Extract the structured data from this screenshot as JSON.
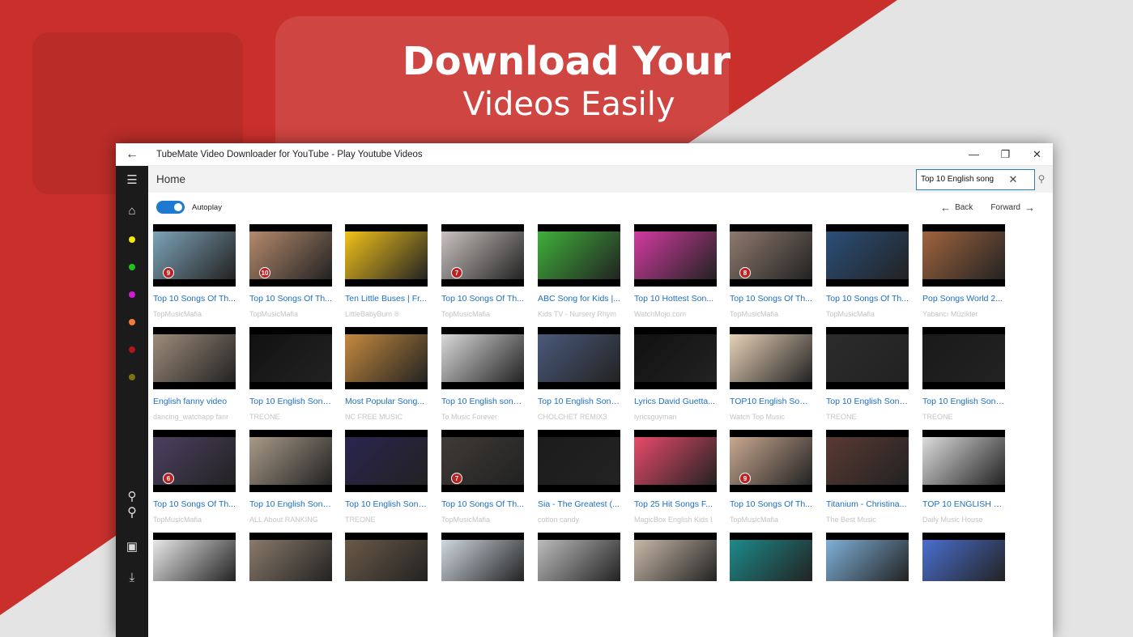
{
  "headline": {
    "line1": "Download Your",
    "line2": "Videos Easily"
  },
  "window": {
    "title": "TubeMate Video Downloader for YouTube - Play Youtube Videos"
  },
  "header": {
    "page_title": "Home",
    "search_value": "Top 10 English song"
  },
  "controls": {
    "autoplay_label": "Autoplay",
    "autoplay_on": true,
    "back_label": "Back",
    "forward_label": "Forward"
  },
  "sidebar": {
    "icons": [
      "menu-icon",
      "home-icon",
      "pin-icon",
      "search-icon",
      "video-camera-icon",
      "download-icon"
    ],
    "dots": [
      "#f2e70f",
      "#22c21e",
      "#d21ad6",
      "#f07b3a",
      "#b3161a",
      "#7a7311"
    ]
  },
  "accent": "#1e7ad1",
  "videos": [
    [
      {
        "title": "Top 10 Songs Of Th...",
        "channel": "TopMusicMafia",
        "color": "#7da3b8",
        "badge": "9"
      },
      {
        "title": "Top 10 Songs Of Th...",
        "channel": "TopMusicMafia",
        "color": "#b58a6c",
        "badge": "10"
      },
      {
        "title": "Ten Little Buses | Fr...",
        "channel": "LittleBabyBum ®",
        "color": "#f2c21a",
        "badge": ""
      },
      {
        "title": "Top 10 Songs Of Th...",
        "channel": "TopMusicMafia",
        "color": "#c9c2c0",
        "badge": "7"
      },
      {
        "title": "ABC Song for Kids |...",
        "channel": "Kids TV - Nursery Rhym",
        "color": "#3fb03a",
        "badge": ""
      },
      {
        "title": "Top 10 Hottest Son...",
        "channel": "WatchMojo.com",
        "color": "#d23aa0",
        "badge": ""
      },
      {
        "title": "Top 10 Songs Of Th...",
        "channel": "TopMusicMafia",
        "color": "#8f7a6e",
        "badge": "8"
      },
      {
        "title": "Top 10 Songs Of Th...",
        "channel": "TopMusicMafia",
        "color": "#2b4f7a",
        "badge": ""
      },
      {
        "title": "Pop Songs World 2...",
        "channel": "Yabancı Müzikler",
        "color": "#a0643e",
        "badge": ""
      }
    ],
    [
      {
        "title": "English fanny video",
        "channel": "dancing_watchapp fanr",
        "color": "#9e8c7a",
        "badge": ""
      },
      {
        "title": "Top 10 English Song...",
        "channel": "TREONE",
        "color": "#111",
        "badge": ""
      },
      {
        "title": "Most Popular Song...",
        "channel": "NC FREE MUSIC",
        "color": "#c58a3e",
        "badge": ""
      },
      {
        "title": "Top 10 English song...",
        "channel": "To Music Forever",
        "color": "#d9d9d9",
        "badge": ""
      },
      {
        "title": "Top 10 English Song...",
        "channel": "CHOLCHET REMIX3",
        "color": "#4a5a7a",
        "badge": ""
      },
      {
        "title": "Lyrics David Guetta...",
        "channel": "lyricsguyman",
        "color": "#111",
        "badge": ""
      },
      {
        "title": "TOP10 English Song...",
        "channel": "Watch Top Music",
        "color": "#e8d2b8",
        "badge": ""
      },
      {
        "title": "Top 10 English Song...",
        "channel": "TREONE",
        "color": "#2b2b2b",
        "badge": ""
      },
      {
        "title": "Top 10 English Song...",
        "channel": "TREONE",
        "color": "#1a1a1a",
        "badge": ""
      }
    ],
    [
      {
        "title": "Top 10 Songs Of Th...",
        "channel": "TopMusicMafia",
        "color": "#4b4060",
        "badge": "6"
      },
      {
        "title": "Top 10 English Song...",
        "channel": "ALL About RANKING",
        "color": "#a89a88",
        "badge": ""
      },
      {
        "title": "Top 10 English Song...",
        "channel": "TREONE",
        "color": "#2a2450",
        "badge": ""
      },
      {
        "title": "Top 10 Songs Of Th...",
        "channel": "TopMusicMafia",
        "color": "#3e3a36",
        "badge": "7"
      },
      {
        "title": "Sia - The Greatest (...",
        "channel": "cotton candy",
        "color": "#1c1c1c",
        "badge": ""
      },
      {
        "title": "Top 25 Hit Songs F...",
        "channel": "MagicBox English Kids I",
        "color": "#e84a6a",
        "badge": ""
      },
      {
        "title": "Top 10 Songs Of Th...",
        "channel": "TopMusicMafia",
        "color": "#c9a890",
        "badge": "9"
      },
      {
        "title": "Titanium - Christina...",
        "channel": "The Best Music",
        "color": "#5a3a32",
        "badge": ""
      },
      {
        "title": "TOP 10 ENGLISH S...",
        "channel": "Daily Music House",
        "color": "#dcdcdc",
        "badge": ""
      }
    ],
    [
      {
        "title": "",
        "channel": "",
        "color": "#e8e8e8",
        "badge": ""
      },
      {
        "title": "",
        "channel": "",
        "color": "#8a7a6a",
        "badge": ""
      },
      {
        "title": "",
        "channel": "",
        "color": "#6a5a48",
        "badge": ""
      },
      {
        "title": "",
        "channel": "",
        "color": "#cfd8e0",
        "badge": ""
      },
      {
        "title": "",
        "channel": "",
        "color": "#bcbcbc",
        "badge": ""
      },
      {
        "title": "",
        "channel": "",
        "color": "#c8b8a8",
        "badge": ""
      },
      {
        "title": "",
        "channel": "",
        "color": "#1d8a8a",
        "badge": ""
      },
      {
        "title": "",
        "channel": "",
        "color": "#7fb0d8",
        "badge": ""
      },
      {
        "title": "",
        "channel": "",
        "color": "#4a6fd0",
        "badge": ""
      }
    ]
  ]
}
